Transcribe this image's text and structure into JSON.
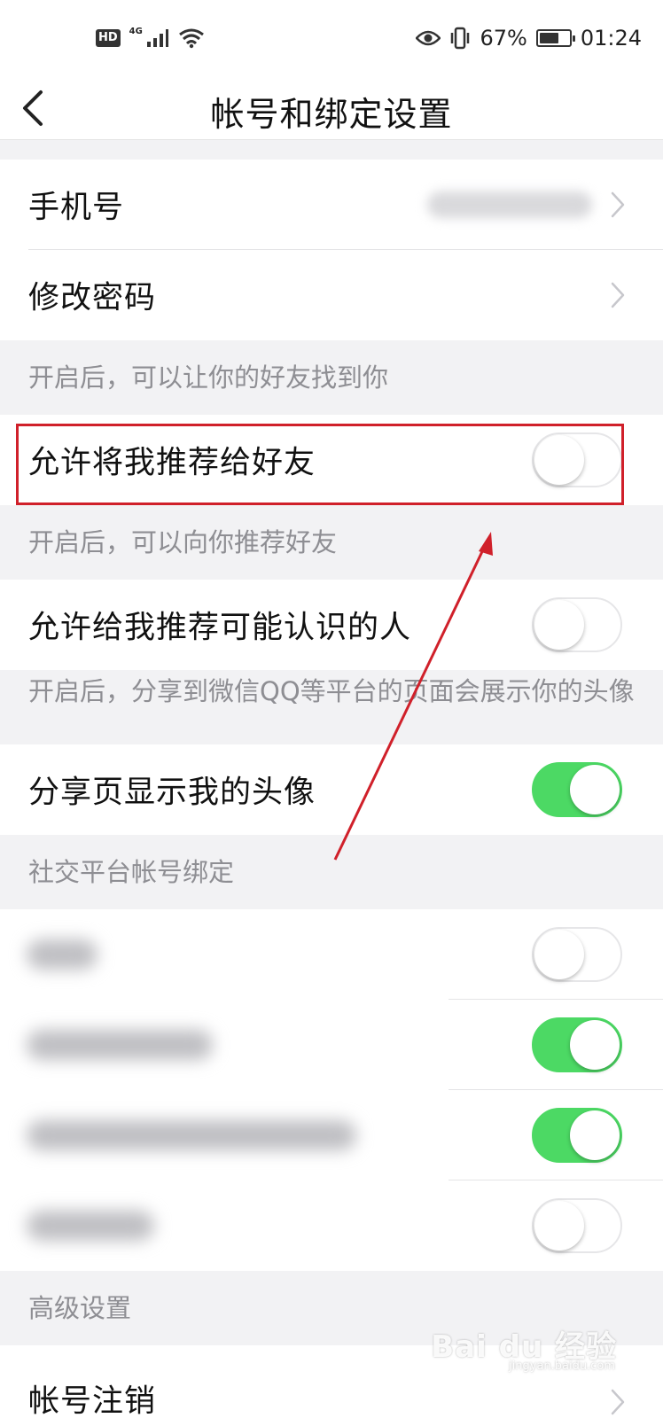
{
  "status_bar": {
    "network_badge": "HD",
    "network_type": "4G",
    "icons": [
      "hd-icon",
      "signal-icon",
      "wifi-icon",
      "eye-icon",
      "vibrate-icon",
      "battery-icon"
    ],
    "battery_percent": "67%",
    "battery_level": 0.67,
    "time": "01:24"
  },
  "nav": {
    "back_icon": "chevron-left-icon",
    "title": "帐号和绑定设置"
  },
  "account": {
    "phone_label": "手机号",
    "password_label": "修改密码"
  },
  "privacy": {
    "caption_1": "开启后，可以让你的好友找到你",
    "recommend_me_label": "允许将我推荐给好友",
    "recommend_me_on": false,
    "caption_2": "开启后，可以向你推荐好友",
    "recommend_to_me_label": "允许给我推荐可能认识的人",
    "recommend_to_me_on": false,
    "caption_3": "开启后，分享到微信QQ等平台的页面会展示你的头像",
    "show_avatar_label": "分享页显示我的头像",
    "show_avatar_on": true
  },
  "social": {
    "caption": "社交平台帐号绑定",
    "bindings": [
      {
        "on": false
      },
      {
        "on": true
      },
      {
        "on": true
      },
      {
        "on": false
      }
    ]
  },
  "advanced": {
    "caption": "高级设置",
    "deactivate_label": "帐号注销"
  },
  "colors": {
    "toggle_on": "#4cd964",
    "highlight": "#d0202a",
    "caption_text": "#8e8e93",
    "background": "#f2f2f4"
  },
  "watermark": {
    "text": "Bai du 经验",
    "sub": "jingyan.baidu.com"
  }
}
